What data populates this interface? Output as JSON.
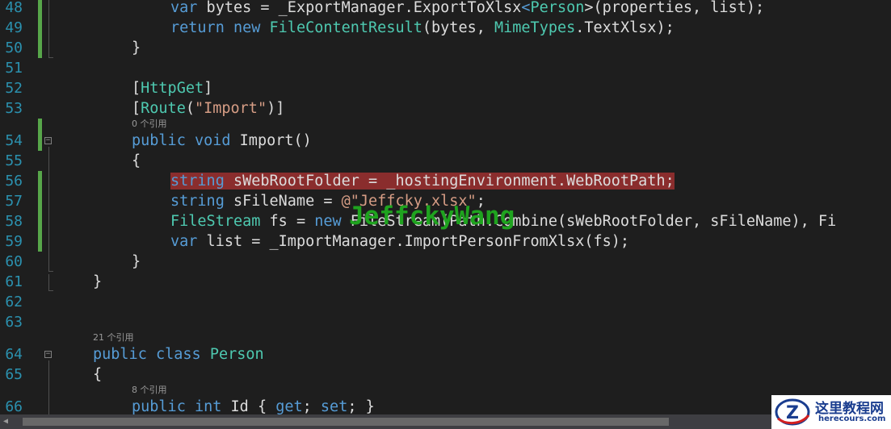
{
  "editor": {
    "colors": {
      "background": "#1e1e1e",
      "line_number": "#2b91af",
      "keyword": "#569cd6",
      "type": "#4ec9b0",
      "string": "#d69d85",
      "breakpoint_highlight": "#8a2d2d",
      "change_bar": "#57a64a"
    },
    "line_numbers": [
      "48",
      "49",
      "50",
      "51",
      "52",
      "53",
      "54",
      "55",
      "56",
      "57",
      "58",
      "59",
      "60",
      "61",
      "62",
      "63",
      "64",
      "65",
      "66"
    ],
    "ref_hints": {
      "import_method": "0 个引用",
      "person_class": "21 个引用",
      "id_property": "8 个引用"
    },
    "code": {
      "l48": {
        "kw": "var",
        "rest1": " bytes = _ExportManager.ExportToXlsx",
        "lt": "<",
        "type": "Person",
        "rest2": ">(properties, list);"
      },
      "l49": {
        "kw1": "return",
        "kw2": "new",
        "type1": "FileContentResult",
        "mid": "(bytes, ",
        "type2": "MimeTypes",
        "rest": ".TextXlsx);"
      },
      "l50": {
        "text": "}"
      },
      "l52": {
        "open": "[",
        "type": "HttpGet",
        "close": "]"
      },
      "l53": {
        "open": "[",
        "type": "Route",
        "paren": "(",
        "str": "\"Import\"",
        "close": ")]"
      },
      "l54": {
        "kw1": "public",
        "kw2": "void",
        "rest": " Import()"
      },
      "l55": {
        "text": "{"
      },
      "l56": {
        "kw": "string",
        "rest": " sWebRootFolder = _hostingEnvironment.WebRootPath;"
      },
      "l57": {
        "kw": "string",
        "rest": " sFileName = ",
        "str": "@\"Jeffcky.xlsx\"",
        "end": ";"
      },
      "l58": {
        "type1": "FileStream",
        "mid": " fs = ",
        "kw": "new",
        "rest": " FileStream(Path.Combine(sWebRootFolder, sFileName), Fi"
      },
      "l59": {
        "kw": "var",
        "rest": " list = _ImportManager.ImportPersonFromXlsx(fs);"
      },
      "l60": {
        "text": "}"
      },
      "l61": {
        "text": "}"
      },
      "l64": {
        "kw1": "public",
        "kw2": "class",
        "type": "Person"
      },
      "l65": {
        "text": "{"
      },
      "l66": {
        "kw1": "public",
        "kw2": "int",
        "rest1": " Id { ",
        "kw3": "get",
        "rest2": "; ",
        "kw4": "set",
        "rest3": "; }"
      }
    },
    "watermark": "JeffckyWang"
  },
  "logo": {
    "title": "这里教程网",
    "url": "herecours.com",
    "mark_letter": "Z"
  },
  "icons": {
    "fold_toggle": "minus-box-icon",
    "scroll_left": "triangle-left-icon"
  }
}
